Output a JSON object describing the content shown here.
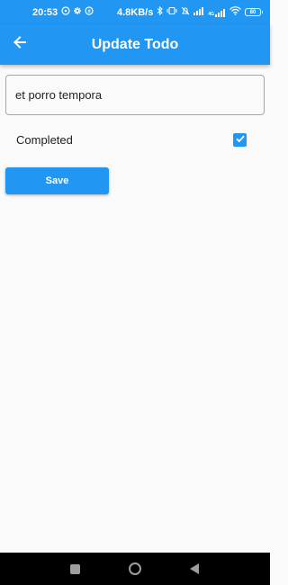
{
  "status_bar": {
    "time": "20:53",
    "net_speed": "4.8KB/s",
    "signal_type": "4G",
    "battery": "80",
    "icons": [
      "whatsapp-icon",
      "settings-icon",
      "notification-icon",
      "bluetooth-icon",
      "vibrate-icon",
      "alarm-off-icon",
      "signal-icon",
      "wifi-icon",
      "battery-icon"
    ]
  },
  "app_bar": {
    "title": "Update Todo",
    "back_icon": "arrow-left-icon"
  },
  "form": {
    "todo_value": "et porro tempora",
    "completed_label": "Completed",
    "completed_checked": true,
    "save_label": "Save"
  },
  "nav_bar": {
    "icons": [
      "recent-apps-icon",
      "home-icon",
      "back-icon"
    ]
  },
  "colors": {
    "primary": "#2196f3",
    "background": "#fafafa",
    "nav_background": "#000000"
  }
}
